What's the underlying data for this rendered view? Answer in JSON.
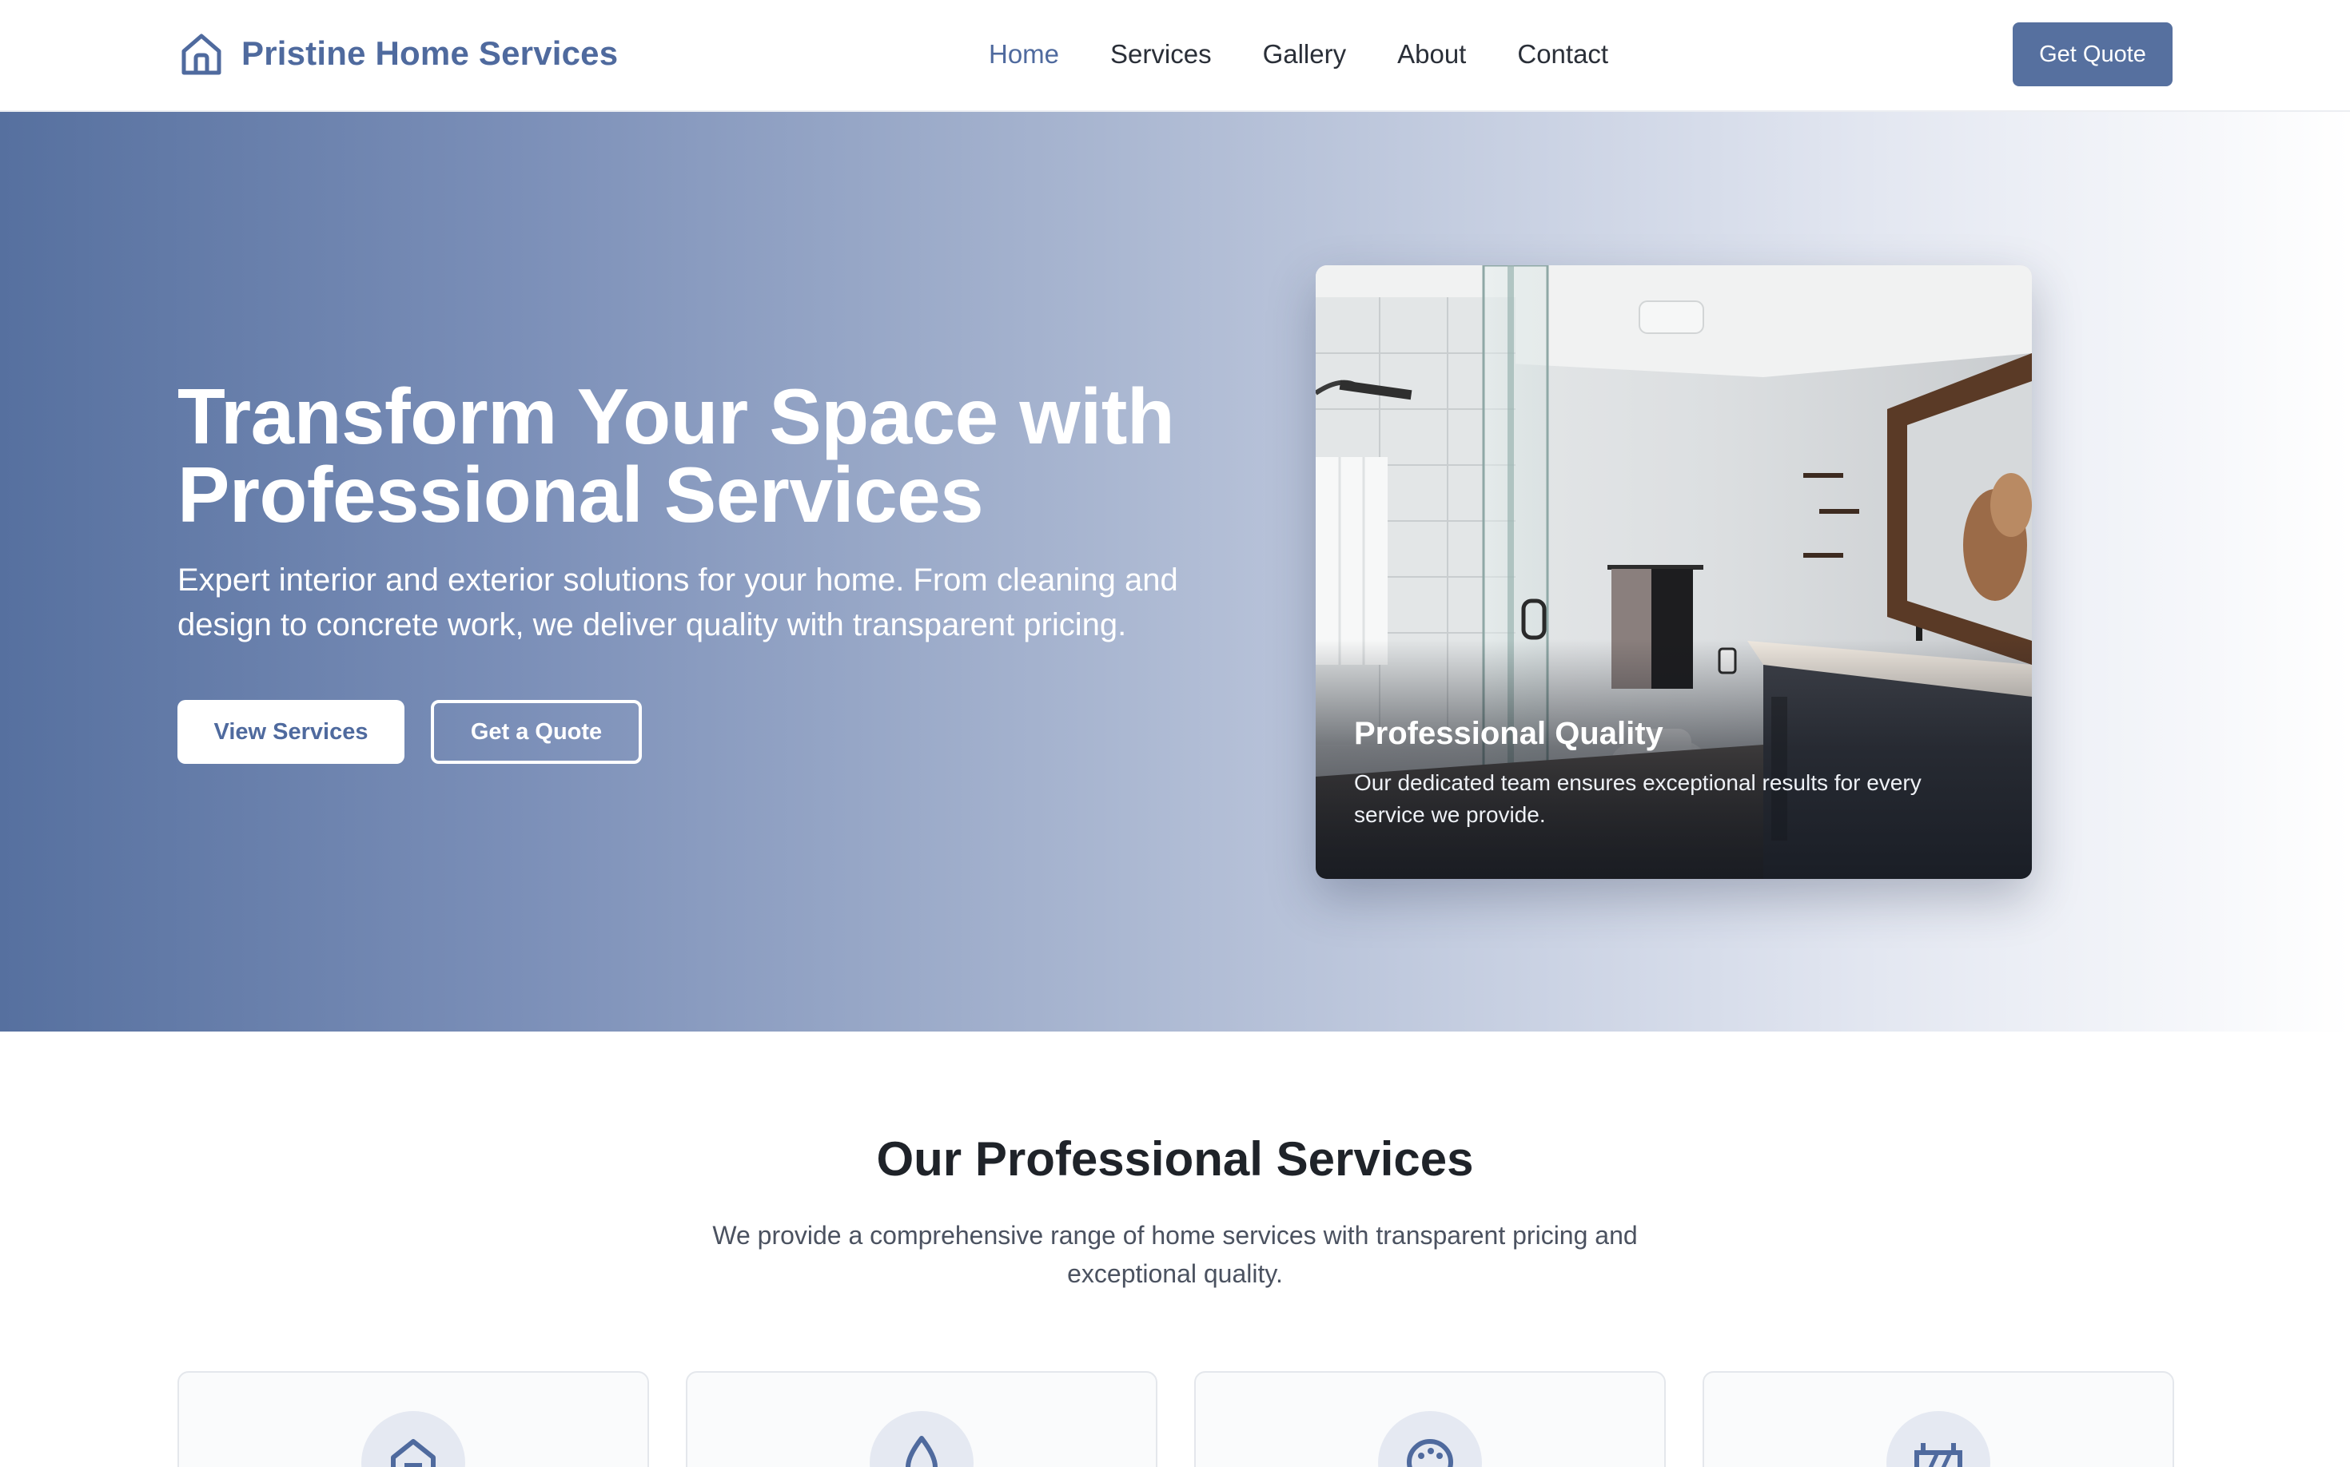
{
  "header": {
    "brand_name": "Pristine Home Services",
    "brand_icon": "house-icon",
    "nav": [
      {
        "label": "Home",
        "active": true
      },
      {
        "label": "Services",
        "active": false
      },
      {
        "label": "Gallery",
        "active": false
      },
      {
        "label": "About",
        "active": false
      },
      {
        "label": "Contact",
        "active": false
      }
    ],
    "cta_label": "Get Quote"
  },
  "hero": {
    "title_line1": "Transform Your Space with",
    "title_line2": "Professional Services",
    "subtitle": "Expert interior and exterior solutions for your home. From cleaning and design to concrete work, we deliver quality with transparent pricing.",
    "primary_button": "View Services",
    "secondary_button": "Get a Quote",
    "card": {
      "title": "Professional Quality",
      "text": "Our dedicated team ensures exceptional results for every service we provide."
    }
  },
  "services": {
    "title": "Our Professional Services",
    "subtitle": "We provide a comprehensive range of home services with transparent pricing and exceptional quality.",
    "cards": [
      {
        "icon": "home-icon"
      },
      {
        "icon": "droplet-icon"
      },
      {
        "icon": "palette-icon"
      },
      {
        "icon": "concrete-barrier-icon"
      }
    ]
  },
  "colors": {
    "brand": "#4f6a9e",
    "button": "#56709f",
    "hero_gradient_start": "#56709f",
    "hero_gradient_end": "#ffffff"
  }
}
